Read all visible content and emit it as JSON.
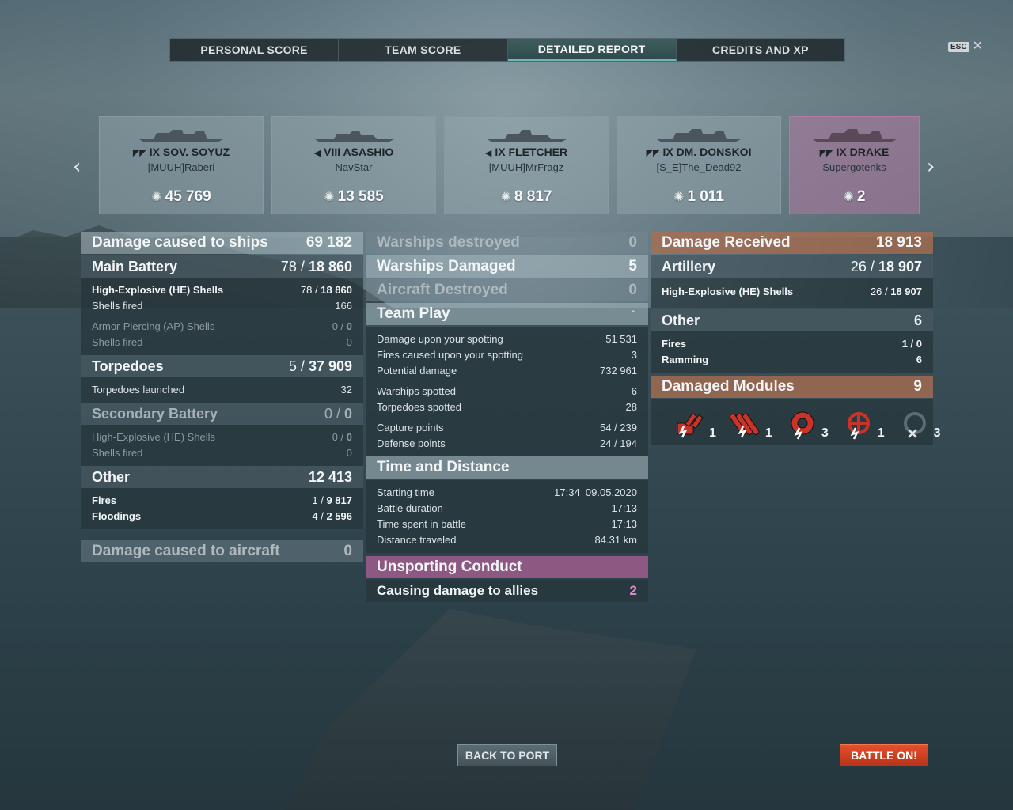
{
  "tabs": [
    {
      "label": "PERSONAL SCORE",
      "active": false
    },
    {
      "label": "TEAM SCORE",
      "active": false
    },
    {
      "label": "DETAILED REPORT",
      "active": true
    },
    {
      "label": "CREDITS AND XP",
      "active": false
    }
  ],
  "esc_label": "ESC",
  "ships": [
    {
      "tier_name": "IX SOV. SOYUZ",
      "player": "[MUUH]Raberi",
      "damage": "45 769",
      "class_icon": "battleship-icon"
    },
    {
      "tier_name": "VIII ASASHIO",
      "player": "NavStar",
      "damage": "13 585",
      "class_icon": "destroyer-icon"
    },
    {
      "tier_name": "IX FLETCHER",
      "player": "[MUUH]MrFragz",
      "damage": "8 817",
      "class_icon": "destroyer-icon"
    },
    {
      "tier_name": "IX DM. DONSKOI",
      "player": "[S_E]The_Dead92",
      "damage": "1 011",
      "class_icon": "cruiser-icon"
    },
    {
      "tier_name": "IX DRAKE",
      "player": "Supergotenks",
      "damage": "2",
      "class_icon": "cruiser-icon"
    }
  ],
  "col1": {
    "damage_ships": {
      "label": "Damage caused to ships",
      "value": "69 182"
    },
    "main_battery": {
      "label": "Main Battery",
      "hits": "78 / ",
      "value": "18 860"
    },
    "he": {
      "label": "High-Explosive (HE) Shells",
      "hits": "78 / ",
      "value": "18 860"
    },
    "he_fired": {
      "label": "Shells fired",
      "value": "166"
    },
    "ap": {
      "label": "Armor-Piercing (AP) Shells",
      "hits": "0 / ",
      "value": "0"
    },
    "ap_fired": {
      "label": "Shells fired",
      "value": "0"
    },
    "torpedoes": {
      "label": "Torpedoes",
      "hits": "5 / ",
      "value": "37 909"
    },
    "torp_launched": {
      "label": "Torpedoes launched",
      "value": "32"
    },
    "secondary": {
      "label": "Secondary Battery",
      "hits": "0 / ",
      "value": "0"
    },
    "sec_he": {
      "label": "High-Explosive (HE) Shells",
      "hits": "0 / ",
      "value": "0"
    },
    "sec_fired": {
      "label": "Shells fired",
      "value": "0"
    },
    "other": {
      "label": "Other",
      "value": "12 413"
    },
    "fires": {
      "label": "Fires",
      "hits": "1 / ",
      "value": "9 817"
    },
    "floodings": {
      "label": "Floodings",
      "hits": "4 / ",
      "value": "2 596"
    },
    "aircraft": {
      "label": "Damage caused to aircraft",
      "value": "0"
    }
  },
  "col2": {
    "destroyed": {
      "label": "Warships destroyed",
      "value": "0"
    },
    "damaged": {
      "label": "Warships Damaged",
      "value": "5"
    },
    "aircraft": {
      "label": "Aircraft Destroyed",
      "value": "0"
    },
    "team_play": {
      "label": "Team Play",
      "chevron": "⌃"
    },
    "spot_dmg": {
      "label": "Damage upon your spotting",
      "value": "51 531"
    },
    "spot_fires": {
      "label": "Fires caused upon your spotting",
      "value": "3"
    },
    "potential": {
      "label": "Potential damage",
      "value": "732 961"
    },
    "spotted": {
      "label": "Warships spotted",
      "value": "6"
    },
    "torp_spotted": {
      "label": "Torpedoes spotted",
      "value": "28"
    },
    "capture": {
      "label": "Capture points",
      "value": "54 / 239"
    },
    "defense": {
      "label": "Defense points",
      "value": "24 / 194"
    },
    "time_dist": {
      "label": "Time and Distance"
    },
    "start": {
      "label": "Starting time",
      "value": "17:34  09.05.2020"
    },
    "duration": {
      "label": "Battle duration",
      "value": "17:13"
    },
    "spent": {
      "label": "Time spent in battle",
      "value": "17:13"
    },
    "distance": {
      "label": "Distance traveled",
      "value": "84.31 km"
    },
    "unsporting": {
      "label": "Unsporting Conduct"
    },
    "allies": {
      "label": "Causing damage to allies",
      "value": "2"
    }
  },
  "col3": {
    "received": {
      "label": "Damage Received",
      "value": "18 913"
    },
    "artillery": {
      "label": "Artillery",
      "hits": "26 / ",
      "value": "18 907"
    },
    "he": {
      "label": "High-Explosive (HE) Shells",
      "hits": "26 / ",
      "value": "18 907"
    },
    "other": {
      "label": "Other",
      "value": "6"
    },
    "fires": {
      "label": "Fires",
      "value": "1 / 0"
    },
    "ramming": {
      "label": "Ramming",
      "value": "6"
    },
    "modules": {
      "label": "Damaged Modules",
      "value": "9"
    },
    "module_list": [
      {
        "icon": "main-gun-module-icon",
        "count": "1"
      },
      {
        "icon": "torpedo-tube-module-icon",
        "count": "1"
      },
      {
        "icon": "engine-module-icon",
        "count": "3"
      },
      {
        "icon": "steering-module-icon",
        "count": "1"
      },
      {
        "icon": "incapacitated-module-icon",
        "count": "3"
      }
    ]
  },
  "buttons": {
    "back": "BACK TO PORT",
    "battle": "BATTLE ON!"
  },
  "colors": {
    "accent_orange": "#d9452a",
    "pink_value": "#e389c9",
    "brown_header": "#aa6e50",
    "pink_header": "#a86092"
  }
}
